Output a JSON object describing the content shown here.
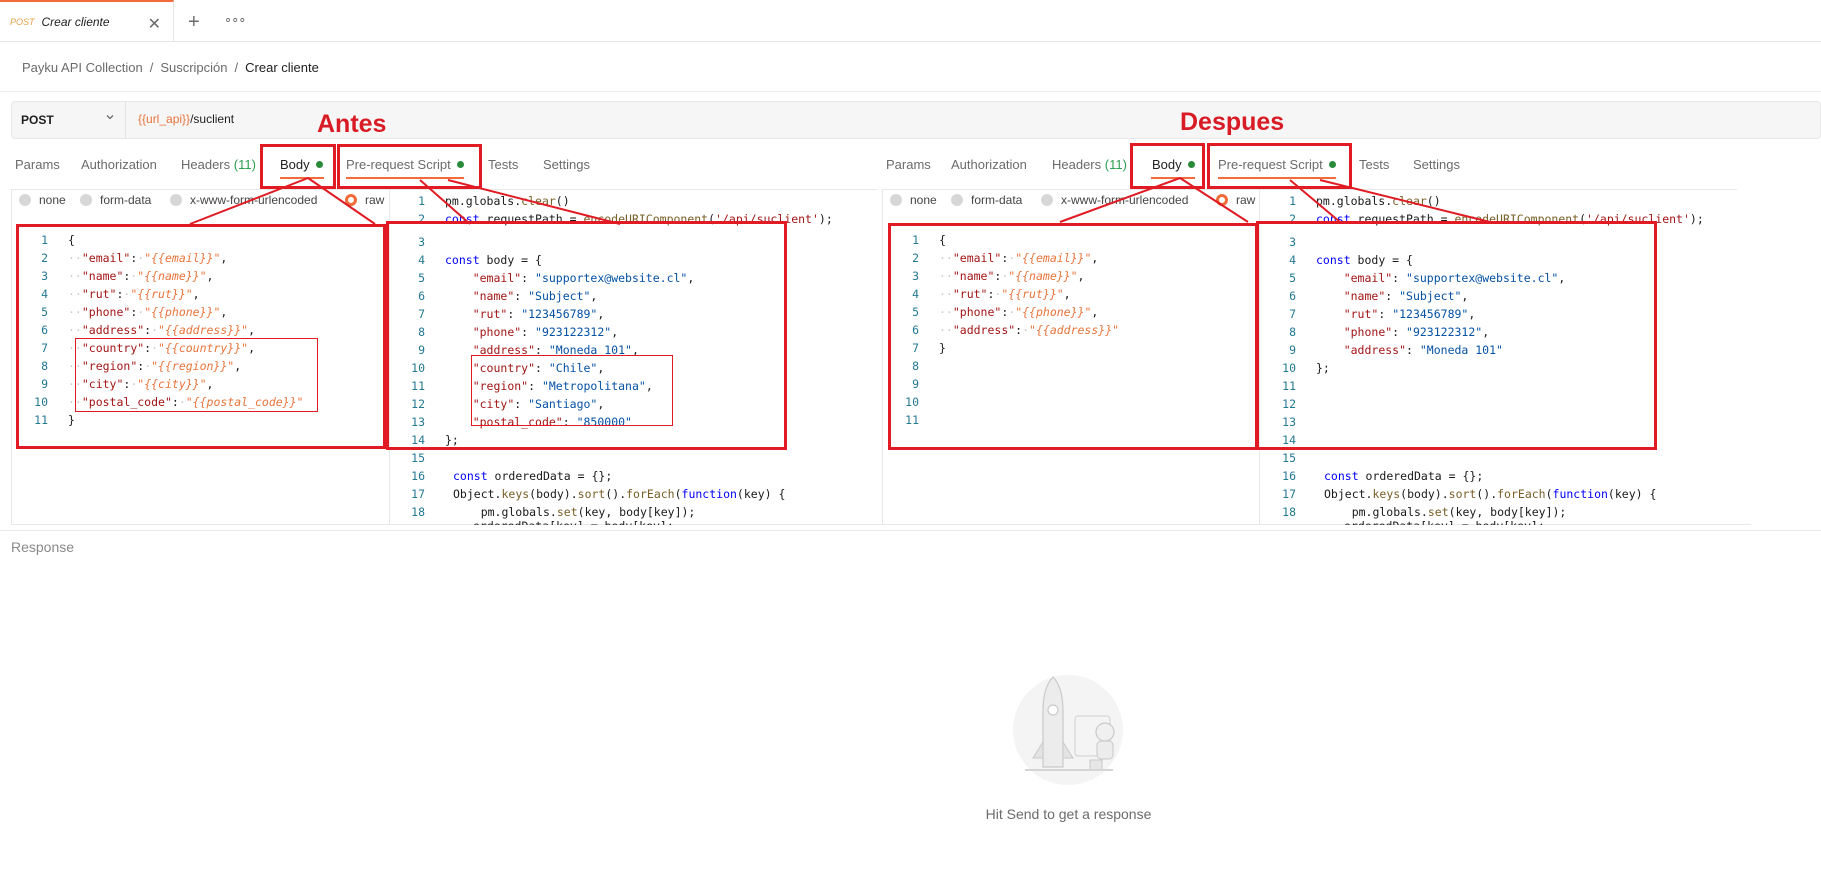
{
  "tab": {
    "method": "POST",
    "name": "Crear cliente",
    "close": "✕",
    "plus": "+",
    "more": "∘∘∘"
  },
  "breadcrumb": {
    "root": "Payku API Collection",
    "sep": "/",
    "folder": "Suscripción",
    "current": "Crear cliente"
  },
  "request": {
    "method": "POST",
    "url_var": "{{url_api}}",
    "url_path": "/suclient"
  },
  "annotations": {
    "left": "Antes",
    "right": "Despues"
  },
  "request_tabs": {
    "params": "Params",
    "authorization": "Authorization",
    "headers": "Headers",
    "headers_count": "(11)",
    "body": "Body",
    "prerequest": "Pre-request Script",
    "tests": "Tests",
    "settings": "Settings"
  },
  "body_modes": {
    "none": "none",
    "form_data": "form-data",
    "urlencoded": "x-www-form-urlencoded",
    "raw": "raw"
  },
  "response": {
    "label": "Response",
    "hint": "Hit Send to get a response"
  },
  "icons": {
    "close": "close-icon",
    "add": "plus-icon",
    "more": "more-icon",
    "chevron": "chevron-down-icon",
    "illustration": "rocket-astronaut-illustration"
  },
  "colors": {
    "accent": "#f26b3a",
    "annotation": "#e01b24",
    "active_dot": "#2a8a3a"
  }
}
